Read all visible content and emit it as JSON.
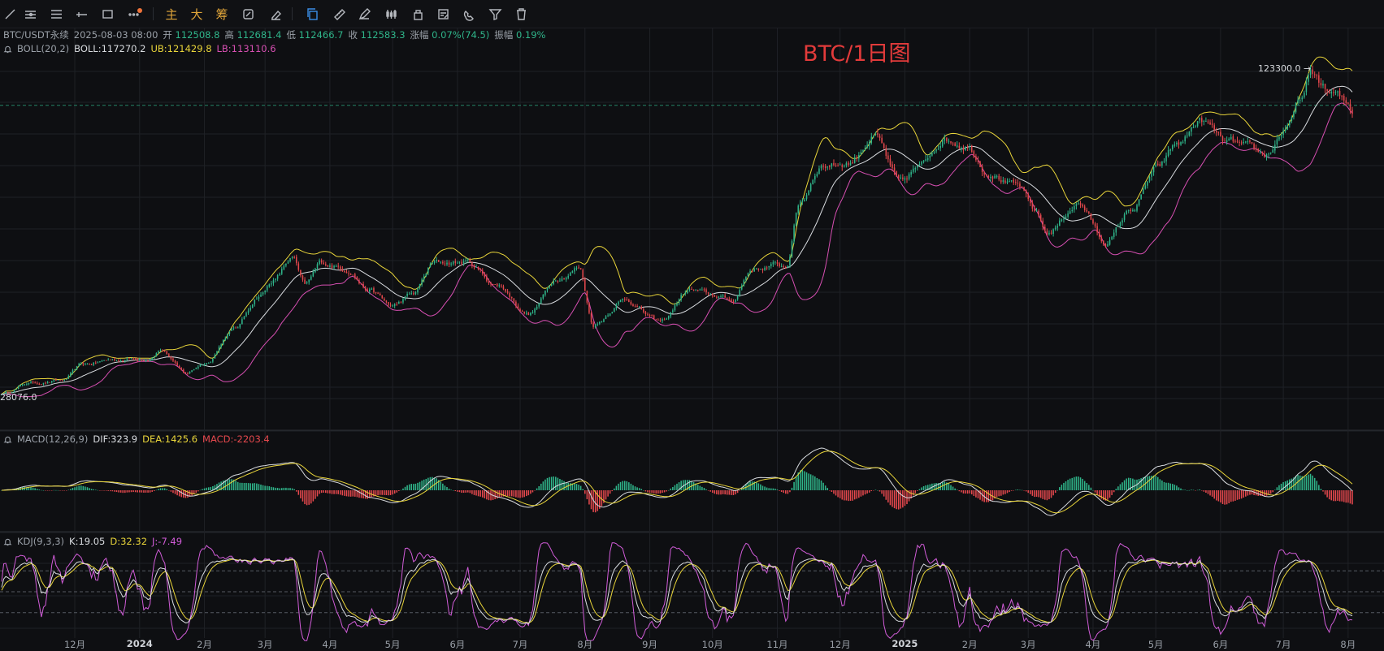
{
  "toolbar": {
    "tools": [
      {
        "icon": "trend-line-icon"
      },
      {
        "icon": "parallel-lines-icon"
      },
      {
        "icon": "horizontal-lines-icon"
      },
      {
        "icon": "segment-icon"
      },
      {
        "icon": "rectangle-icon"
      },
      {
        "icon": "more-icon"
      }
    ],
    "text_buttons": [
      "主",
      "大",
      "筹"
    ],
    "right_tools": [
      {
        "icon": "refresh-icon"
      },
      {
        "icon": "eraser-icon"
      },
      {
        "icon": "copy-icon",
        "active": true
      },
      {
        "icon": "ruler-icon"
      },
      {
        "icon": "pen-icon"
      },
      {
        "icon": "candles-icon"
      },
      {
        "icon": "lock-icon"
      },
      {
        "icon": "edit-list-icon"
      },
      {
        "icon": "magnet-icon"
      },
      {
        "icon": "filter-icon"
      },
      {
        "icon": "trash-icon"
      }
    ]
  },
  "header": {
    "symbol": "BTC/USDT永续",
    "datetime": "2025-08-03 08:00",
    "open_label": "开",
    "open": "112508.8",
    "high_label": "高",
    "high": "112681.4",
    "low_label": "低",
    "low": "112466.7",
    "close_label": "收",
    "close": "112583.3",
    "change_label": "涨幅",
    "change": "0.07%(74.5)",
    "amp_label": "振幅",
    "amp": "0.19%"
  },
  "boll": {
    "name": "BOLL(20,2)",
    "mid": "BOLL:117270.2",
    "ub": "UB:121429.8",
    "lb": "LB:113110.6"
  },
  "macd": {
    "name": "MACD(12,26,9)",
    "dif": "DIF:323.9",
    "dea": "DEA:1425.6",
    "macd": "MACD:-2203.4"
  },
  "kdj": {
    "name": "KDJ(9,3,3)",
    "k": "K:19.05",
    "d": "D:32.32",
    "j": "J:-7.49"
  },
  "watermark": "BTC/1日图",
  "price_high_tag": "123300.0",
  "price_low_tag": "28076.0",
  "colors": {
    "up": "#2fb58a",
    "down": "#e5484d",
    "mid": "#d9dce0",
    "ub": "#e9d53a",
    "lb": "#d74fb2",
    "background": "#0e0f12",
    "grid": "#1f2126",
    "watermark": "#e23b3b"
  },
  "chart_data": {
    "type": "candlestick",
    "title": "BTC/1日图",
    "xlabel": "",
    "ylabel": "",
    "ylim": [
      25000,
      130000
    ],
    "x_tick_labels": [
      "12月",
      "2024",
      "2月",
      "3月",
      "4月",
      "5月",
      "6月",
      "7月",
      "8月",
      "9月",
      "10月",
      "11月",
      "12月",
      "2025",
      "2月",
      "3月",
      "4月",
      "5月",
      "6月",
      "7月",
      "8月"
    ],
    "x_tick_dates": [
      "2023-12-01",
      "2024-01-01",
      "2024-02-01",
      "2024-03-01",
      "2024-04-01",
      "2024-05-01",
      "2024-06-01",
      "2024-07-01",
      "2024-08-01",
      "2024-09-01",
      "2024-10-01",
      "2024-11-01",
      "2024-12-01",
      "2025-01-01",
      "2025-02-01",
      "2025-03-01",
      "2025-04-01",
      "2025-05-01",
      "2025-06-01",
      "2025-07-01",
      "2025-08-01"
    ],
    "x_start": "2023-10-27",
    "x_end": "2025-08-03",
    "series": [
      {
        "name": "BTC/USDT永续 close",
        "points": [
          [
            "2023-10-27",
            34000
          ],
          [
            "2023-11-10",
            37000
          ],
          [
            "2023-11-25",
            37500
          ],
          [
            "2023-12-05",
            42000
          ],
          [
            "2023-12-20",
            43500
          ],
          [
            "2024-01-05",
            44000
          ],
          [
            "2024-01-11",
            46500
          ],
          [
            "2024-01-23",
            39500
          ],
          [
            "2024-02-01",
            42500
          ],
          [
            "2024-02-15",
            52000
          ],
          [
            "2024-02-28",
            62000
          ],
          [
            "2024-03-05",
            66000
          ],
          [
            "2024-03-14",
            72000
          ],
          [
            "2024-03-20",
            64000
          ],
          [
            "2024-03-28",
            70500
          ],
          [
            "2024-04-10",
            69000
          ],
          [
            "2024-04-19",
            63500
          ],
          [
            "2024-05-01",
            58500
          ],
          [
            "2024-05-10",
            61500
          ],
          [
            "2024-05-21",
            70500
          ],
          [
            "2024-06-05",
            71000
          ],
          [
            "2024-06-20",
            64500
          ],
          [
            "2024-07-05",
            56500
          ],
          [
            "2024-07-20",
            67000
          ],
          [
            "2024-07-29",
            69500
          ],
          [
            "2024-08-05",
            53500
          ],
          [
            "2024-08-20",
            60500
          ],
          [
            "2024-09-06",
            54000
          ],
          [
            "2024-09-20",
            63000
          ],
          [
            "2024-10-01",
            61500
          ],
          [
            "2024-10-10",
            60000
          ],
          [
            "2024-10-20",
            69000
          ],
          [
            "2024-10-31",
            70000
          ],
          [
            "2024-11-05",
            69500
          ],
          [
            "2024-11-12",
            88000
          ],
          [
            "2024-11-22",
            98500
          ],
          [
            "2024-12-05",
            99000
          ],
          [
            "2024-12-17",
            106500
          ],
          [
            "2024-12-30",
            92500
          ],
          [
            "2025-01-07",
            97000
          ],
          [
            "2025-01-20",
            106000
          ],
          [
            "2025-01-30",
            104500
          ],
          [
            "2025-02-10",
            97000
          ],
          [
            "2025-02-24",
            92000
          ],
          [
            "2025-03-04",
            85000
          ],
          [
            "2025-03-10",
            79000
          ],
          [
            "2025-03-25",
            87500
          ],
          [
            "2025-04-07",
            76500
          ],
          [
            "2025-04-20",
            86000
          ],
          [
            "2025-05-01",
            96500
          ],
          [
            "2025-05-12",
            104000
          ],
          [
            "2025-05-22",
            110500
          ],
          [
            "2025-06-05",
            104000
          ],
          [
            "2025-06-22",
            100500
          ],
          [
            "2025-07-03",
            109000
          ],
          [
            "2025-07-10",
            117000
          ],
          [
            "2025-07-14",
            123000
          ],
          [
            "2025-07-25",
            118000
          ],
          [
            "2025-08-01",
            114500
          ],
          [
            "2025-08-03",
            112583
          ]
        ]
      }
    ],
    "indicators": [
      "BOLL(20,2)",
      "MACD(12,26,9)",
      "KDJ(9,3,3)"
    ]
  }
}
